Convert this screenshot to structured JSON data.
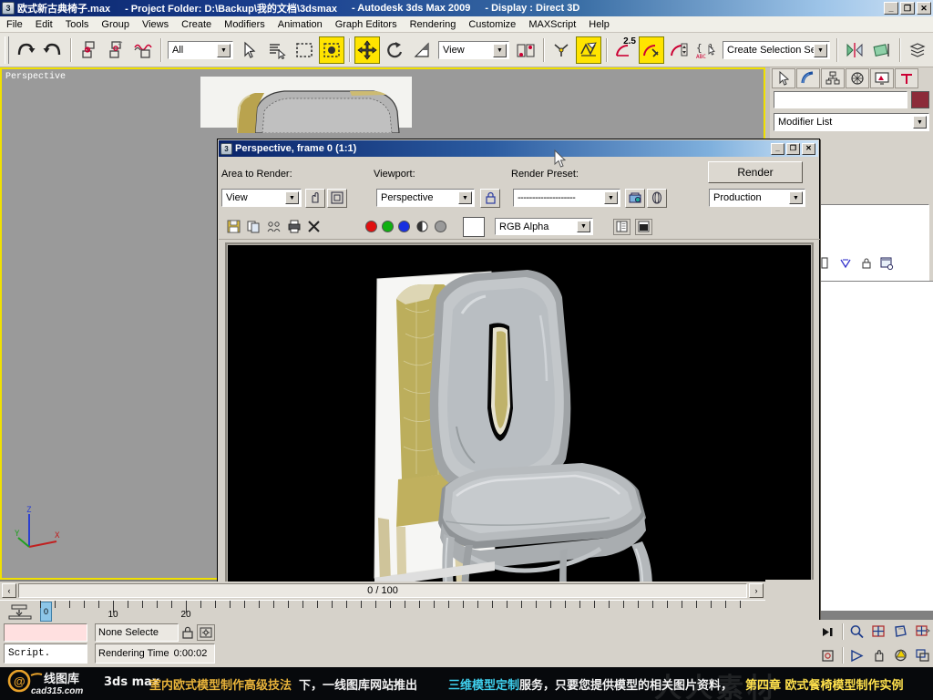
{
  "titlebar": {
    "icon": "max-logo-icon",
    "file": "欧式新古典椅子.max",
    "project": "- Project Folder: D:\\Backup\\我的文档\\3dsmax",
    "app": "- Autodesk 3ds Max  2009",
    "display": "- Display : Direct 3D",
    "minimize": "_",
    "restore": "❐",
    "close": "✕"
  },
  "menubar": {
    "items": [
      {
        "label": "File"
      },
      {
        "label": "Edit"
      },
      {
        "label": "Tools"
      },
      {
        "label": "Group"
      },
      {
        "label": "Views"
      },
      {
        "label": "Create"
      },
      {
        "label": "Modifiers"
      },
      {
        "label": "Animation"
      },
      {
        "label": "Graph Editors"
      },
      {
        "label": "Rendering"
      },
      {
        "label": "Customize"
      },
      {
        "label": "MAXScript"
      },
      {
        "label": "Help"
      }
    ]
  },
  "toolbar": {
    "selection_filter": "All",
    "ref_coord_system": "View",
    "named_selection_set": "Create Selection Set",
    "snap_percent": "2.5",
    "buttons": [
      "undo-icon",
      "redo-icon",
      "select-link-icon",
      "unlink-icon",
      "bind-to-space-warp-icon",
      "select-object-icon",
      "select-by-name-icon",
      "select-region-icon",
      "select-and-move-icon",
      "select-and-rotate-icon",
      "select-and-scale-icon",
      "mirror-icon",
      "align-icon",
      "layer-manager-icon",
      "curve-editor-icon",
      "schematic-view-icon",
      "material-editor-icon",
      "render-setup-icon",
      "render-frame-window-icon"
    ]
  },
  "viewport": {
    "label": "Perspective",
    "axis": {
      "x": "X",
      "y": "Y",
      "z": "Z"
    }
  },
  "command_panel": {
    "tabs": [
      "create-tab-icon",
      "modify-tab-icon",
      "hierarchy-tab-icon",
      "motion-tab-icon",
      "display-tab-icon",
      "utilities-tab-icon"
    ],
    "object_name": "",
    "object_color": "#8c2b39",
    "modifier_list": "Modifier List",
    "stack_buttons": [
      "pin-stack-icon",
      "show-end-result-icon",
      "make-unique-icon",
      "remove-modifier-icon",
      "configure-sets-icon"
    ]
  },
  "render_dialog": {
    "title": "Perspective, frame 0 (1:1)",
    "icon": "max-logo-icon",
    "minimize": "_",
    "restore": "❐",
    "close": "✕",
    "labels": {
      "area": "Area to Render:",
      "viewport": "Viewport:",
      "preset": "Render Preset:"
    },
    "area_to_render": "View",
    "viewport_value": "Perspective",
    "render_preset": "--------------------",
    "production_value": "Production",
    "render_button": "Render",
    "channel_value": "RGB Alpha",
    "area_buttons": [
      "auto-region-selected-icon",
      "blowup-region-icon"
    ],
    "lock_button": "lock-viewport-icon",
    "preset_buttons": [
      "render-preset-load-icon",
      "render-setup-icon"
    ],
    "toolbar2_buttons": [
      "save-bitmap-icon",
      "copy-bitmap-icon",
      "clone-rendered-frame-icon",
      "print-bitmap-icon",
      "clear-icon"
    ],
    "channels": [
      "red-channel-icon",
      "green-channel-icon",
      "blue-channel-icon",
      "alpha-channel-icon",
      "monochrome-icon"
    ],
    "display_buttons": [
      "toggle-ui-icon",
      "duplicate-display-icon"
    ],
    "background_swatch": "#ffffff"
  },
  "timeline": {
    "prev_frame": "‹",
    "next_frame": "›",
    "frame_readout": "0 / 100",
    "slider_value": "0",
    "ticks": [
      "10",
      "20"
    ],
    "key_mode_icon": "set-key-mode-icon"
  },
  "status": {
    "prompt_value": "",
    "script_label": "Script.",
    "selection": "None Selecte",
    "rendering_time_label": "Rendering Time",
    "rendering_time_value": "0:00:02",
    "lock_icon": "selection-lock-icon",
    "coord_icon": "absolute-mode-icon"
  },
  "viewport_nav": {
    "row1": [
      "go-to-end-icon",
      "zoom-icon",
      "zoom-all-icon",
      "zoom-extents-icon",
      "zoom-extents-all-icon"
    ],
    "row2": [
      "key-mode-toggle-icon",
      "field-of-view-icon",
      "pan-view-icon",
      "arc-rotate-icon",
      "maximize-viewport-toggle-icon"
    ]
  },
  "banner": {
    "logo_main": "线图库",
    "logo_sub": "cad315.com",
    "text1": "3ds  max",
    "text2": "室内欧式模型制作高级技法",
    "text3": "下，一线图库网站推出",
    "text4": "三维模型定制",
    "text5": "服务，只要您提供模型的相关图片资料，",
    "text6": "第四章  欧式餐椅模型制作实例",
    "watermark": "人人素材",
    "colors": {
      "gold": "#e8b33a",
      "white": "#f2f2f2",
      "cyan": "#3fd0ee",
      "yellow": "#ffe14d"
    }
  }
}
